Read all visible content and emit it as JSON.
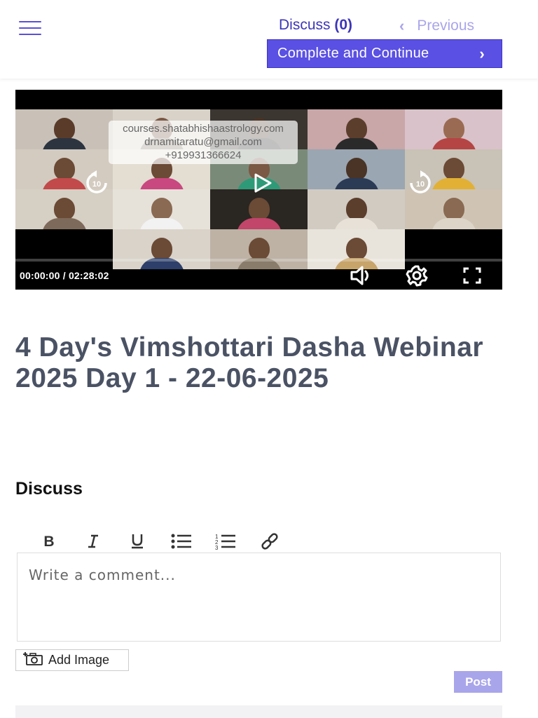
{
  "header": {
    "menu_icon": "hamburger-icon",
    "discuss_label": "Discuss",
    "discuss_count": "(0)",
    "previous_label": "Previous",
    "previous_icon": "chevron-left-icon",
    "complete_label": "Complete and Continue",
    "complete_icon": "chevron-right-icon",
    "accent_color": "#5a50e3"
  },
  "video": {
    "watermark_lines": [
      "courses.shatabhishaastrology.com",
      "drnamitaratu@gmail.com",
      "+919931366624"
    ],
    "rewind_label": "10",
    "forward_label": "10",
    "current_time": "00:00:00",
    "separator": "/",
    "duration": "02:28:02",
    "progress": 0,
    "icons": [
      "rewind-10-icon",
      "play-icon",
      "forward-10-icon",
      "volume-icon",
      "gear-icon",
      "fullscreen-icon"
    ]
  },
  "lesson": {
    "title": "4 Day's Vimshottari Dasha Webinar 2025 Day 1 - 22-06-2025"
  },
  "discuss": {
    "heading": "Discuss",
    "toolbar": [
      "bold-icon",
      "italic-icon",
      "underline-icon",
      "bulleted-list-icon",
      "numbered-list-icon",
      "link-icon"
    ],
    "comment_placeholder": "Write a comment...",
    "add_image_label": "Add Image",
    "add_image_icon": "camera-plus-icon",
    "post_label": "Post",
    "post_color": "#a9a5ea"
  }
}
